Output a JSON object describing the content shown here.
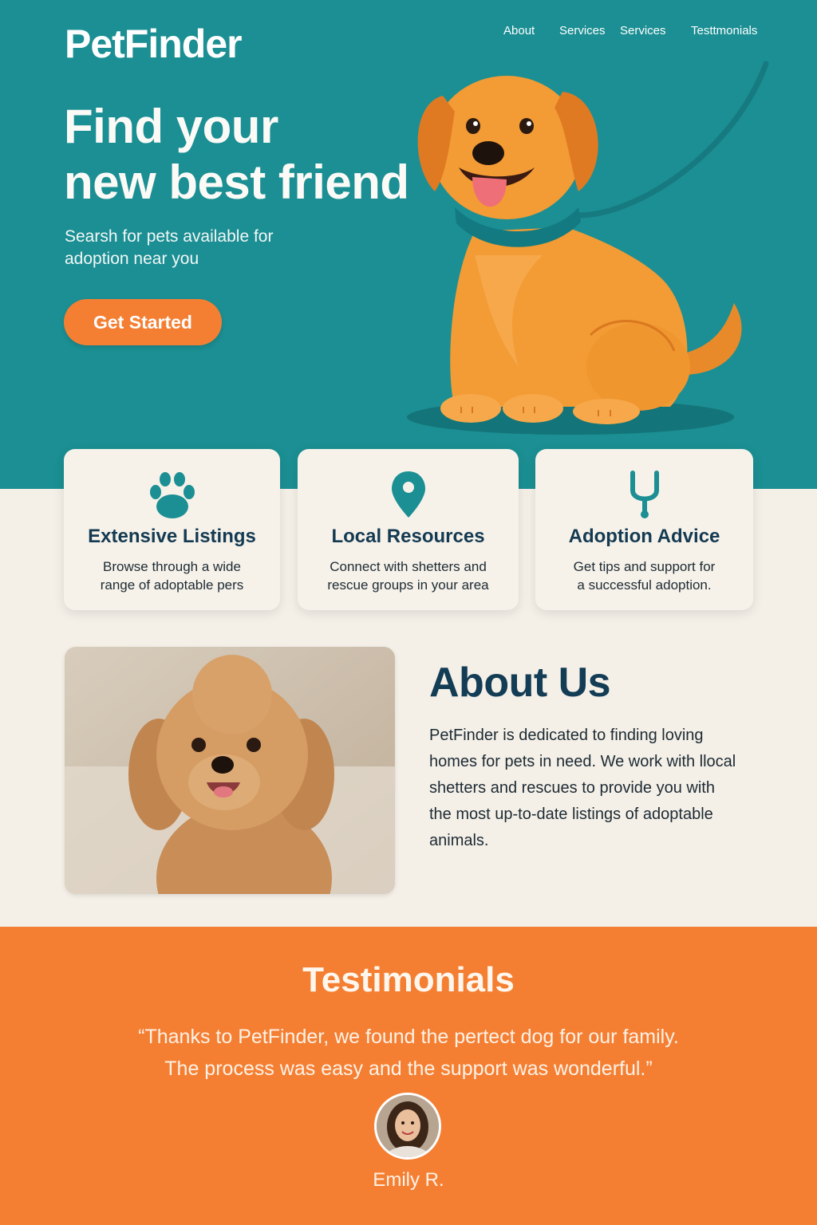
{
  "header": {
    "brand": "PetFinder",
    "nav": [
      "About",
      "Services",
      "Services",
      "Testtmonials"
    ]
  },
  "hero": {
    "title_line1": "Find your",
    "title_line2": "new best friend",
    "subtitle_line1": "Searsh for pets available for",
    "subtitle_line2": "adoption near you",
    "cta": "Get Started"
  },
  "features": [
    {
      "icon": "paw-icon",
      "title": "Extensive Listings",
      "line1": "Browse through a wide",
      "line2": "range of adoptable pers"
    },
    {
      "icon": "location-pin-icon",
      "title": "Local Resources",
      "line1": "Connect with shetters and",
      "line2": "rescue groups in your area"
    },
    {
      "icon": "stethoscope-icon",
      "title": "Adoption Advice",
      "line1": "Get tips and support for",
      "line2": "a successful adoption."
    }
  ],
  "about": {
    "title": "About Us",
    "lines": [
      "PetFinder is dedicated to finding loving",
      "homes for pets in need. We work with llocal",
      "shetters and rescues to provide you with",
      "the most up-to-date listings of adoptable",
      "animals."
    ]
  },
  "testimonials": {
    "title": "Testimonials",
    "quote_line1": "“Thanks to PetFinder, we found the pertect dog for our family.",
    "quote_line2": "The process was easy and the support was wonderful.”",
    "author": "Emily R."
  },
  "colors": {
    "teal": "#1b8f93",
    "orange": "#f47f33",
    "cream": "#f4f0e8",
    "navy": "#133c55"
  }
}
